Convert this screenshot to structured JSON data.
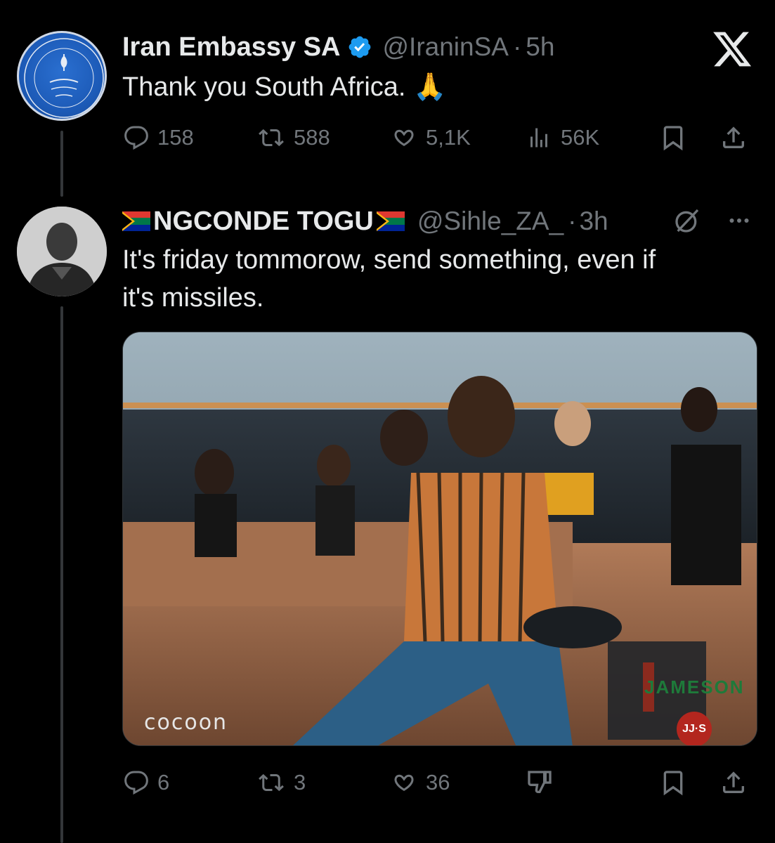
{
  "tweet1": {
    "name": "Iran Embassy SA",
    "handle": "@IraninSA",
    "time": "5h",
    "text": "Thank you South Africa. 🙏",
    "replies": "158",
    "retweets": "588",
    "likes": "5,1K",
    "views": "56K"
  },
  "tweet2": {
    "name": "NGCONDE TOGU",
    "handle": "@Sihle_ZA_",
    "time": "3h",
    "text_line1": "It's friday tommorow, send something, even if",
    "text_line2": "it's missiles.",
    "replies": "6",
    "retweets": "3",
    "likes": "36",
    "media_watermark": "cocoon",
    "media_brand": "JAMESON",
    "media_badge": "JJ·S"
  },
  "colors": {
    "background": "#000000",
    "text": "#e7e9ea",
    "muted": "#71767b",
    "verified": "#1d9bf0"
  },
  "icons": [
    "x-logo-icon",
    "verified-badge-icon",
    "reply-icon",
    "retweet-icon",
    "like-icon",
    "views-icon",
    "bookmark-icon",
    "share-icon",
    "grok-icon",
    "more-icon",
    "dislike-icon",
    "flag-icon"
  ]
}
